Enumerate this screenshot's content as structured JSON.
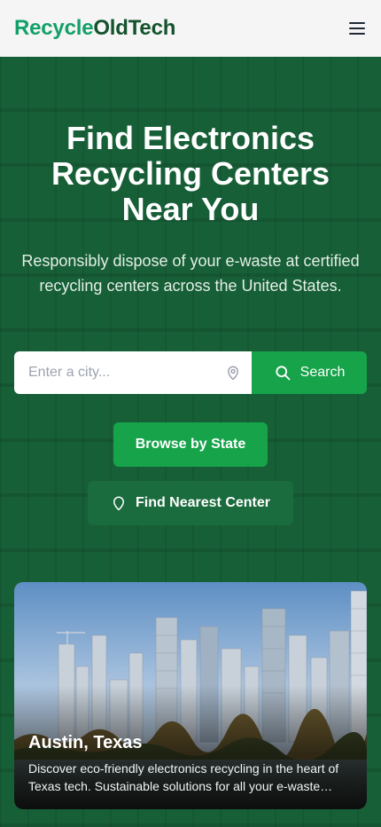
{
  "header": {
    "logo_part1": "Recycle",
    "logo_part2": "OldTech",
    "menu_icon": "hamburger-menu-icon"
  },
  "hero": {
    "title": "Find Electronics Recycling Centers Near You",
    "subtitle": "Responsibly dispose of your e-waste at certified recycling centers across the United States."
  },
  "search": {
    "placeholder": "Enter a city...",
    "value": "",
    "location_icon": "map-pin-icon",
    "button_icon": "search-icon",
    "button_label": "Search"
  },
  "actions": {
    "browse_label": "Browse by State",
    "nearest_label": "Find Nearest Center",
    "nearest_icon": "map-pin-icon"
  },
  "featured_city": {
    "title": "Austin, Texas",
    "description": "Discover eco-friendly electronics recycling in the heart of Texas tech. Sustainable solutions for all your e-waste needs."
  },
  "colors": {
    "brand_green": "#14a06a",
    "brand_dark": "#14532d",
    "hero_bg": "#175f37",
    "button_green": "#16a34a"
  }
}
